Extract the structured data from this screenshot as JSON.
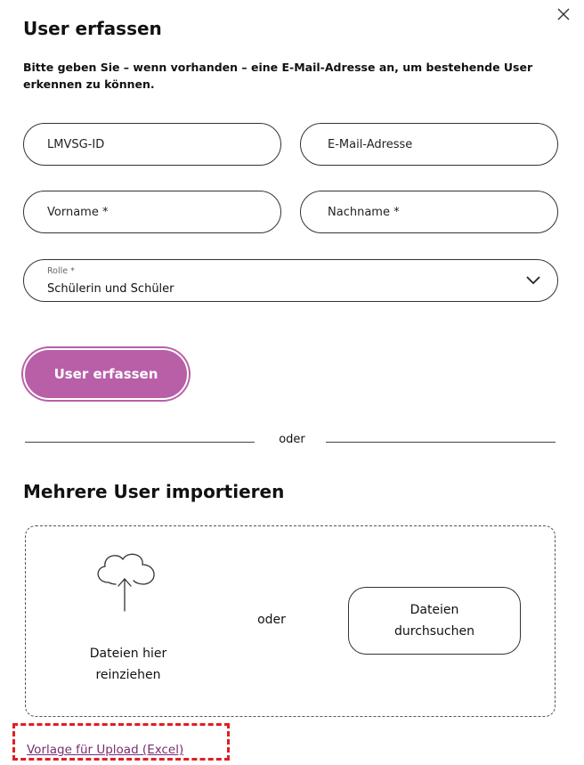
{
  "dialog": {
    "title": "User erfassen",
    "intro": "Bitte geben Sie – wenn vorhanden – eine E-Mail-Adresse an, um bestehende User erkennen zu können.",
    "close_icon": "close-icon"
  },
  "form": {
    "lmvsg_id": {
      "placeholder": "LMVSG-ID",
      "value": ""
    },
    "email": {
      "placeholder": "E-Mail-Adresse",
      "value": ""
    },
    "firstname": {
      "placeholder": "Vorname *",
      "value": ""
    },
    "lastname": {
      "placeholder": "Nachname *",
      "value": ""
    },
    "role": {
      "label": "Rolle *",
      "selected": "Schülerin und Schüler"
    },
    "submit_label": "User erfassen"
  },
  "divider": {
    "text": "oder"
  },
  "import": {
    "title": "Mehrere User importieren",
    "drop_text": "Dateien hier\nreinziehen",
    "or_text": "oder",
    "browse_label": "Dateien\ndurchsuchen",
    "template_link": "Vorlage für Upload (Excel)"
  },
  "colors": {
    "accent": "#b85fa8",
    "link": "#7a2d70",
    "highlight": "#e01e26"
  }
}
